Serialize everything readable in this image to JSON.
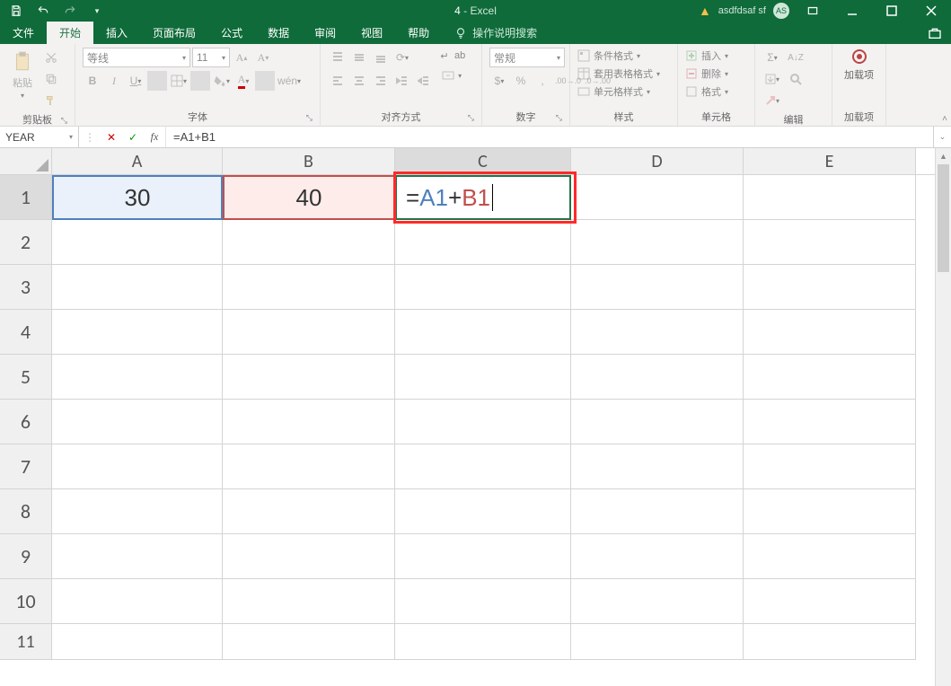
{
  "titlebar": {
    "doc_name": "4",
    "app_name": "Excel",
    "user_label": "asdfdsaf sf",
    "avatar_initials": "AS"
  },
  "tabs": {
    "file": "文件",
    "home": "开始",
    "insert": "插入",
    "layout": "页面布局",
    "formulas": "公式",
    "data": "数据",
    "review": "审阅",
    "view": "视图",
    "help": "帮助",
    "tell_me": "操作说明搜索"
  },
  "ribbon": {
    "clipboard": {
      "paste": "粘贴",
      "label": "剪贴板"
    },
    "font": {
      "name": "等线",
      "size": "11",
      "bold": "B",
      "italic": "I",
      "underline": "U",
      "ruby": "wén",
      "label": "字体"
    },
    "alignment": {
      "wrap": "ab",
      "label": "对齐方式"
    },
    "number": {
      "format": "常规",
      "label": "数字"
    },
    "styles": {
      "conditional": "条件格式",
      "table": "套用表格格式",
      "cell": "单元格样式",
      "label": "样式"
    },
    "cells": {
      "insert": "插入",
      "delete": "删除",
      "format": "格式",
      "label": "单元格"
    },
    "editing": {
      "label": "编辑"
    },
    "addins": {
      "label": "加载项",
      "btn": "加载项"
    }
  },
  "formula_bar": {
    "name_box": "YEAR",
    "fx": "fx",
    "formula": "=A1+B1"
  },
  "sheet": {
    "columns": [
      "A",
      "B",
      "C",
      "D",
      "E"
    ],
    "rows": [
      "1",
      "2",
      "3",
      "4",
      "5",
      "6",
      "7",
      "8",
      "9",
      "10"
    ],
    "cells": {
      "A1": "30",
      "B1": "40",
      "C1_tokens": {
        "eq": "=",
        "a": "A1",
        "plus": "+",
        "b": "B1"
      }
    }
  }
}
